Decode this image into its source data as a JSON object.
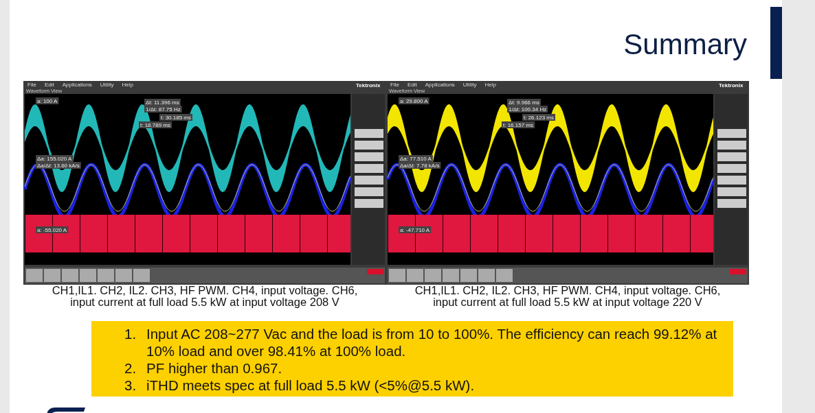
{
  "slide": {
    "title": "Summary"
  },
  "scopes": [
    {
      "brand": "Tektronix",
      "menu": [
        "File",
        "Edit",
        "Applications",
        "Utility",
        "Help"
      ],
      "view_title": "Waveform View",
      "color": "#22b8b8",
      "readouts": [
        "a: 100 A",
        "Δt: 11.396 ms",
        "1/Δt: 87.75 Hz",
        "t: 30.185 ms",
        "t: 18.789 ms",
        "Δa: 155.020 A",
        "Δa/Δt: 13.60 kA/s",
        "a: -55.020 A"
      ],
      "caption_lines": [
        "CH1,IL1. CH2, IL2. CH3, HF PWM. CH4, input voltage. CH6,",
        "input current at full load 5.5 kW at input voltage 208 V"
      ]
    },
    {
      "brand": "Tektronix",
      "menu": [
        "File",
        "Edit",
        "Applications",
        "Utility",
        "Help"
      ],
      "view_title": "Waveform View",
      "color": "#f2e600",
      "readouts": [
        "a: 29.800 A",
        "Δt: 9.966 ms",
        "1/Δt: 100.34 Hz",
        "t: 26.123 ms",
        "t: 16.157 ms",
        "Δa: 77.510 A",
        "Δa/Δt: 7.78 kA/s",
        "a: -47.710 A"
      ],
      "caption_lines": [
        "CH1,IL1. CH2, IL2. CH3, HF PWM. CH4, input voltage. CH6,",
        "input current at full load 5.5 kW at input voltage 220 V"
      ]
    }
  ],
  "summary": {
    "items": [
      {
        "number": "1.",
        "text": "Input AC 208~277 Vac and the load is from 10 to 100%. The efficiency can reach 99.12% at 10% load and over 98.41% at 100% load."
      },
      {
        "number": "2.",
        "text": "PF higher than 0.967."
      },
      {
        "number": "3.",
        "text": "iTHD meets spec at full load 5.5 kW (<5%@5.5 kW)."
      }
    ]
  }
}
